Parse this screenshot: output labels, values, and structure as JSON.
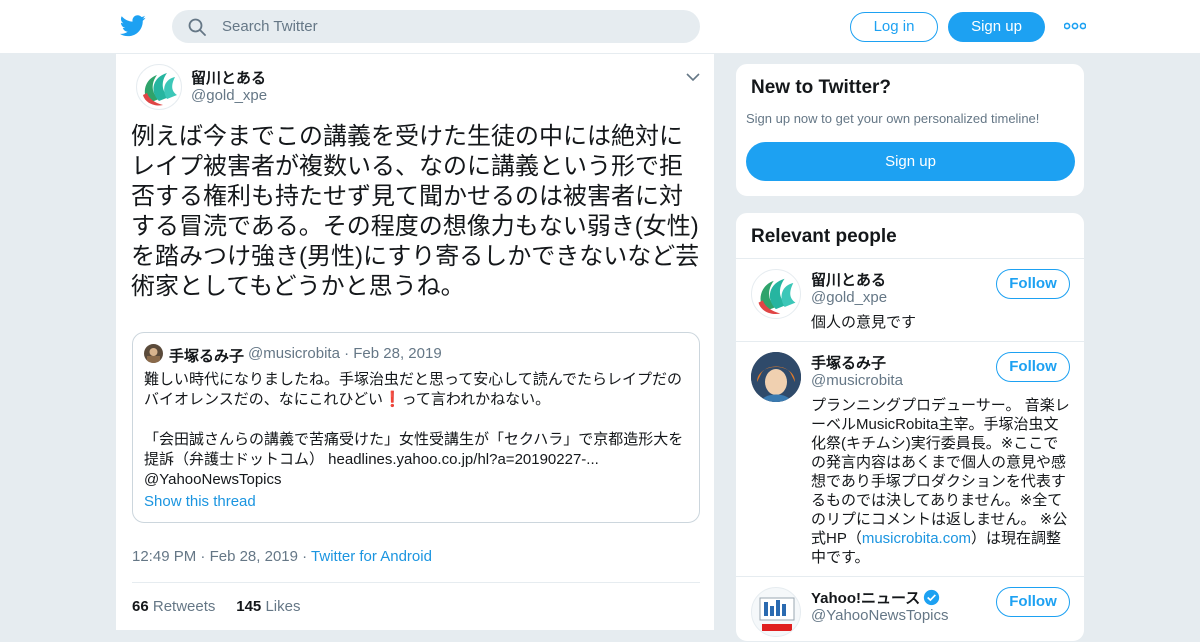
{
  "header": {
    "search_placeholder": "Search Twitter",
    "login_label": "Log in",
    "signup_label": "Sign up",
    "more_icon": "more-dots-icon"
  },
  "tweet": {
    "author_name": "留川とある",
    "author_handle": "@gold_xpe",
    "text": "例えば今までこの講義を受けた生徒の中には絶対にレイプ被害者が複数いる、なのに講義という形で拒否する権利も持たせず見て聞かせるのは被害者に対する冒涜である。その程度の想像力もない弱き(女性)を踏みつけ強き(男性)にすり寄るしかできないなど芸術家としてもどうかと思うね。",
    "quote": {
      "name": "手塚るみ子",
      "handle": "@musicrobita",
      "sep": "·",
      "date": "Feb 28, 2019",
      "line1": "難しい時代になりましたね。手塚治虫だと思って安心して読んでたらレイプだのバイオレンスだの、なにこれひどい",
      "emoji": "❗",
      "line1_end": "って言われかねない。",
      "line2": "「会田誠さんらの講義で苦痛受けた」女性受講生が「セクハラ」で京都造形大を提訴（弁護士ドットコム） headlines.yahoo.co.jp/hl?a=20190227-... @YahooNewsTopics",
      "show_thread": "Show this thread"
    },
    "time": "12:49 PM",
    "sep": "·",
    "date": "Feb 28, 2019",
    "source": "Twitter for Android",
    "retweets_count": "66",
    "retweets_label": "Retweets",
    "likes_count": "145",
    "likes_label": "Likes"
  },
  "new_to_twitter": {
    "title": "New to Twitter?",
    "subtitle": "Sign up now to get your own personalized timeline!",
    "button": "Sign up"
  },
  "relevant_people": {
    "title": "Relevant people",
    "people": [
      {
        "name": "留川とある",
        "handle": "@gold_xpe",
        "follow": "Follow",
        "bio": "個人の意見です"
      },
      {
        "name": "手塚るみ子",
        "handle": "@musicrobita",
        "follow": "Follow",
        "bio_a": "プランニングプロデューサー。 音楽レーベルMusicRobita主宰。手塚治虫文化祭(キチムシ)実行委員長。※ここでの発言内容はあくまで個人の意見や感想であり手塚プロダクションを代表するものでは決してありません。※全てのリプにコメントは返しません。 ※公式HP（",
        "bio_link": "musicrobita.com",
        "bio_b": "）は現在調整中です。"
      },
      {
        "name": "Yahoo!ニュース",
        "handle": "@YahooNewsTopics",
        "follow": "Follow",
        "verified_icon": "verified-badge-icon"
      }
    ]
  },
  "colors": {
    "accent": "#1da1f2",
    "link": "#1b95e0",
    "muted": "#657786"
  }
}
